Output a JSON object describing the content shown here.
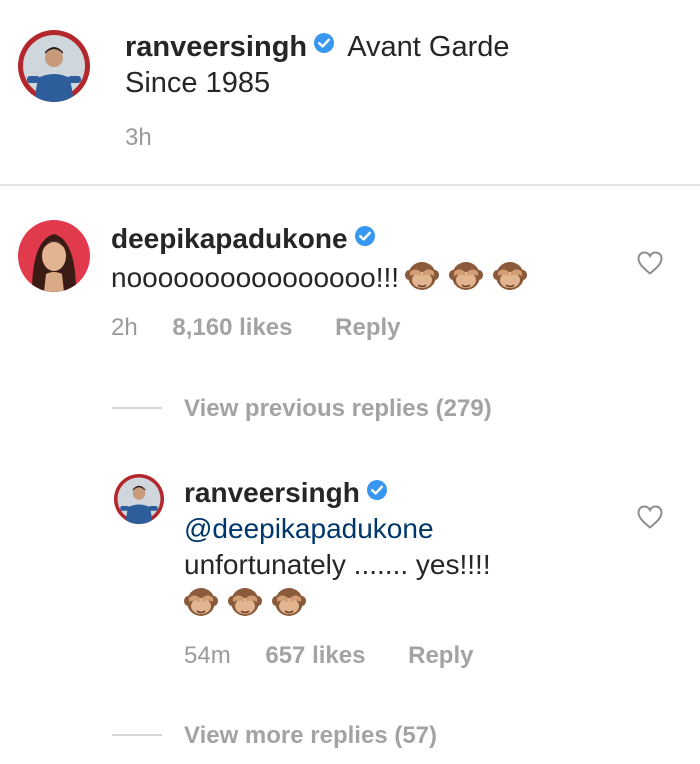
{
  "caption": {
    "username": "ranveersingh",
    "text_line1": "Avant Garde",
    "text_line2": "Since 1985",
    "time": "3h"
  },
  "comment": {
    "username": "deepikapadukone",
    "text": "noooooooooooooooo!!!",
    "time": "2h",
    "likes": "8,160 likes",
    "reply_label": "Reply",
    "emoji": "see-no-evil-monkey-emoji"
  },
  "view_previous": "View previous replies (279)",
  "reply": {
    "username": "ranveersingh",
    "mention": "@deepikapadukone",
    "text": "unfortunately ....... yes!!!!",
    "time": "54m",
    "likes": "657 likes",
    "reply_label": "Reply",
    "emoji": "see-no-evil-monkey-emoji"
  },
  "view_more": "View more replies (57)",
  "icons": {
    "verified": "verified-badge-icon",
    "like": "heart-icon"
  },
  "colors": {
    "verified": "#3897f0",
    "mention": "#00376b",
    "muted": "#9a9a9a"
  }
}
